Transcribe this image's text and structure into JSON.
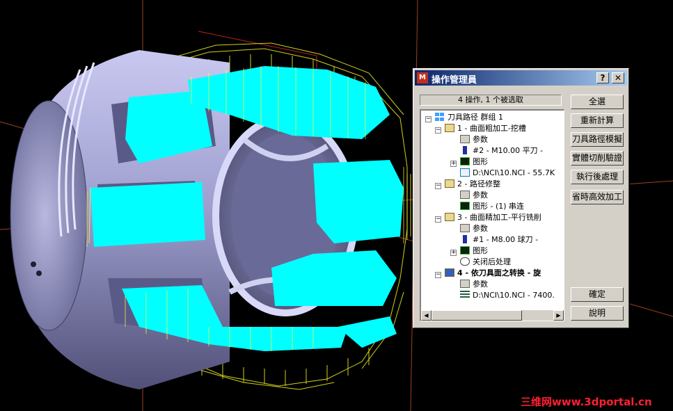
{
  "dialog": {
    "title": "操作管理員",
    "help_label": "?",
    "close_label": "✕",
    "status": "4 操作, 1 个被选取"
  },
  "tree": {
    "root": "刀具路径 群组 1",
    "op1": "1 - 曲面粗加工-挖槽",
    "op1_params": "参数",
    "op1_tool": "#2 - M10.00 平刀 -",
    "op1_geom": "图形",
    "op1_nci": "D:\\NCI\\10.NCI - 55.7K",
    "op2": "2 - 路径修整",
    "op2_params": "参数",
    "op2_geom": "图形 - (1) 串连",
    "op3": "3 - 曲面精加工-平行铣削",
    "op3_params": "参数",
    "op3_tool": "#1 - M8.00 球刀 -",
    "op3_geom": "图形",
    "op3_post": "关闭后处理",
    "op4": "4 - 依刀具面之转换 - 旋",
    "op4_params": "参数",
    "op4_nci": "D:\\NCI\\10.NCI - 7400."
  },
  "buttons": {
    "select_all": "全選",
    "regen": "重新計算",
    "backplot": "刀具路徑模擬",
    "verify": "實體切削驗證",
    "post": "執行後處理",
    "hsm": "省時高效加工",
    "ok": "確定",
    "help": "說明"
  },
  "watermark": "三维网www.3dportal.cn",
  "colors": {
    "toolpath": "#00ffff",
    "toolpath_edge": "#ffff00",
    "part": "#9a9ac8",
    "background": "#000000",
    "titlebar": "#0a246a"
  }
}
